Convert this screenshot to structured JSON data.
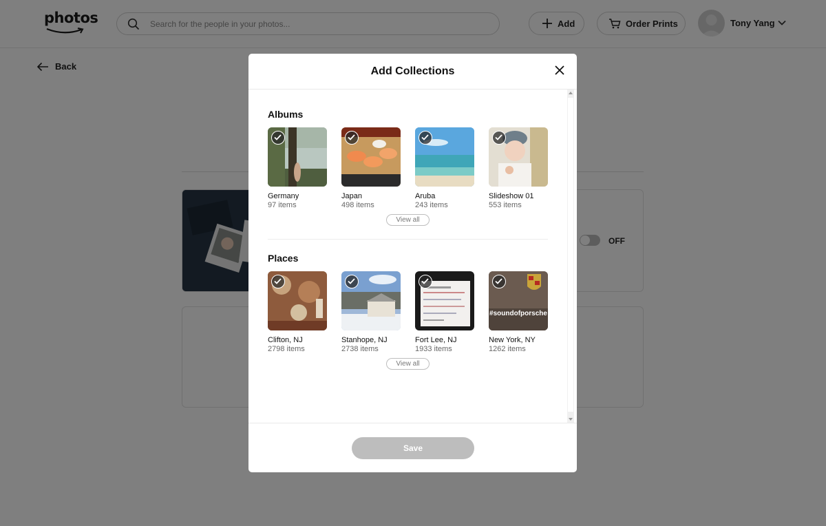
{
  "header": {
    "logo": "photos",
    "search_placeholder": "Search for the people in your photos...",
    "add_label": "Add",
    "order_prints_label": "Order Prints",
    "user_name": "Tony Yang"
  },
  "page": {
    "back_label": "Back",
    "toggle_state": "OFF"
  },
  "modal": {
    "title": "Add Collections",
    "albums": {
      "title": "Albums",
      "view_all": "View all",
      "items": [
        {
          "name": "Germany",
          "count": "97 items",
          "checked": true
        },
        {
          "name": "Japan",
          "count": "498 items",
          "checked": true
        },
        {
          "name": "Aruba",
          "count": "243 items",
          "checked": true
        },
        {
          "name": "Slideshow 01",
          "count": "553 items",
          "checked": true
        }
      ]
    },
    "places": {
      "title": "Places",
      "view_all": "View all",
      "items": [
        {
          "name": "Clifton, NJ",
          "count": "2798 items",
          "checked": true
        },
        {
          "name": "Stanhope, NJ",
          "count": "2738 items",
          "checked": true
        },
        {
          "name": "Fort Lee, NJ",
          "count": "1933 items",
          "checked": true
        },
        {
          "name": "New York, NY",
          "count": "1262 items",
          "checked": true,
          "overlay_text": "#soundofporsche"
        }
      ]
    },
    "save_label": "Save"
  }
}
